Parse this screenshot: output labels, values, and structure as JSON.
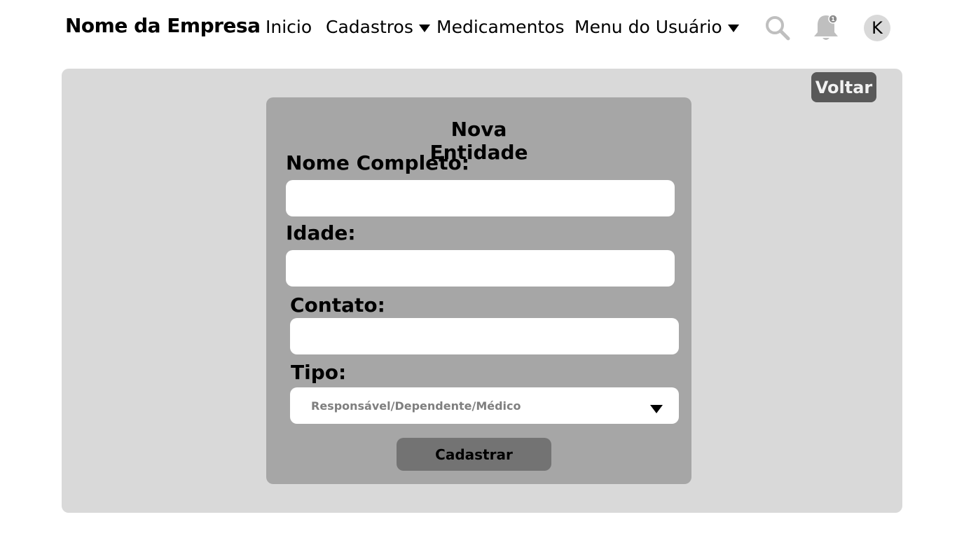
{
  "header": {
    "brand": "Nome da Empresa",
    "nav": {
      "inicio": "Inicio",
      "cadastros": "Cadastros",
      "medicamentos": "Medicamentos",
      "menu_usuario": "Menu do Usuário"
    },
    "notification_count": "1",
    "avatar_initial": "K",
    "icons": [
      "search-icon",
      "bell-icon",
      "chevron-down-icon"
    ]
  },
  "panel": {
    "back_label": "Voltar"
  },
  "form": {
    "title": "Nova Entidade",
    "fields": {
      "nome": {
        "label": "Nome Completo:",
        "value": ""
      },
      "idade": {
        "label": "Idade:",
        "value": ""
      },
      "contato": {
        "label": "Contato:",
        "value": ""
      },
      "tipo": {
        "label": "Tipo:",
        "selected": "Responsável/Dependente/Médico"
      }
    },
    "submit_label": "Cadastrar"
  },
  "colors": {
    "panel_bg": "#d9d9d9",
    "card_bg": "#a6a6a6",
    "back_button": "#595959",
    "submit_button": "#737373",
    "icon_gray": "#bfbfbf"
  }
}
